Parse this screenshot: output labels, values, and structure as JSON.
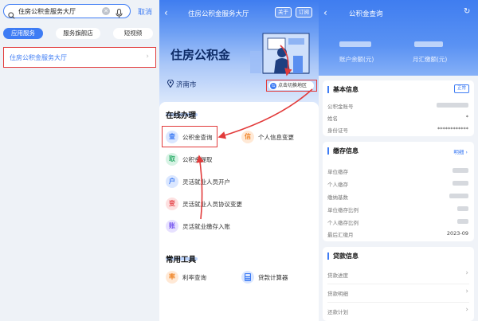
{
  "search": {
    "query": "住房公积金服务大厅",
    "cancel_label": "取消",
    "chips": [
      "应用服务",
      "服务旗舰店",
      "短视频"
    ],
    "result": "住房公积金服务大厅"
  },
  "hall": {
    "title": "住房公积金服务大厅",
    "about_label": "关于",
    "subscribe_label": "订阅",
    "banner_title": "住房公积金",
    "city": "济南市",
    "switch_region": "点击切换地区",
    "online_section": "在线办理",
    "services": [
      {
        "icon_char": "查",
        "label": "公积金查询"
      },
      {
        "icon_char": "信",
        "label": "个人信息变更"
      },
      {
        "icon_char": "取",
        "label": "公积金提取"
      },
      {
        "icon_char": "户",
        "label": "灵活就业人员开户"
      },
      {
        "icon_char": "变",
        "label": "灵活就业人员协议变更"
      },
      {
        "icon_char": "账",
        "label": "灵活就业缴存入账"
      }
    ],
    "tools_section": "常用工具",
    "tools": [
      {
        "icon_char": "率",
        "label": "利率查询"
      },
      {
        "icon_char": "calculator-icon",
        "label": "贷款计算器"
      }
    ]
  },
  "query": {
    "title": "公积金查询",
    "balance_label": "账户余额(元)",
    "monthly_label": "月汇缴额(元)",
    "basic_title": "基本信息",
    "status_badge": "正常",
    "basic_rows": [
      {
        "label": "公积金账号"
      },
      {
        "label": "姓名",
        "value": "*"
      },
      {
        "label": "身份证号",
        "value": "************"
      }
    ],
    "deposit_title": "缴存信息",
    "detail_link": "明细",
    "deposit_rows": [
      {
        "label": "单位缴存"
      },
      {
        "label": "个人缴存"
      },
      {
        "label": "缴纳基数"
      },
      {
        "label": "单位缴存比例"
      },
      {
        "label": "个人缴存比例"
      },
      {
        "label": "最后汇缴月",
        "value": "2023-09"
      }
    ],
    "loan_title": "贷款信息",
    "loan_rows": [
      {
        "label": "贷款进度"
      },
      {
        "label": "贷款明细"
      },
      {
        "label": "还款计划"
      }
    ]
  },
  "colors": {
    "accent": "#3e7cf4",
    "highlight": "#e23b3b"
  }
}
